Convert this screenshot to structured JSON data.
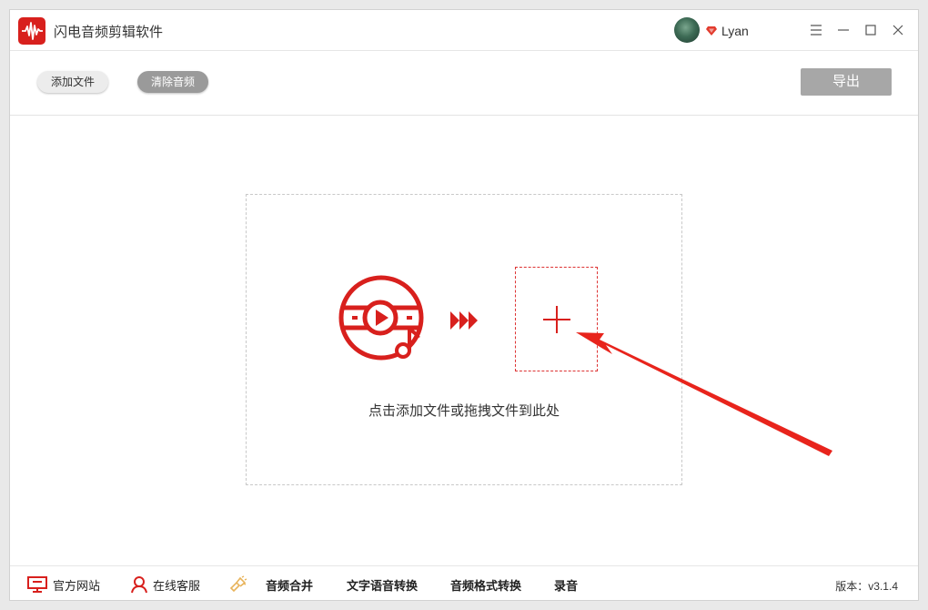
{
  "app": {
    "title": "闪电音频剪辑软件",
    "logo_icon": "waveform-logo-icon",
    "brand_color": "#d8201d"
  },
  "user": {
    "name": "Lyan",
    "badge_icon": "vip-diamond-icon"
  },
  "window_controls": [
    "menu-icon",
    "minimize-icon",
    "maximize-icon",
    "close-icon"
  ],
  "toolbar": {
    "add_file_label": "添加文件",
    "clear_audio_label": "清除音频",
    "export_label": "导出"
  },
  "dropzone": {
    "hint": "点击添加文件或拖拽文件到此处",
    "media_icon": "video-music-icon",
    "arrows_icon": "triple-arrow-icon",
    "add_icon": "plus-icon",
    "accent": "#d8201d"
  },
  "footer": {
    "items": [
      {
        "label": "官方网站",
        "icon": "monitor-icon"
      },
      {
        "label": "在线客服",
        "icon": "person-icon"
      },
      {
        "label": "音频合并",
        "icon": "merge-icon"
      },
      {
        "label": "文字语音转换"
      },
      {
        "label": "音频格式转换"
      },
      {
        "label": "录音"
      }
    ],
    "version": "版本：v3.1.4"
  }
}
